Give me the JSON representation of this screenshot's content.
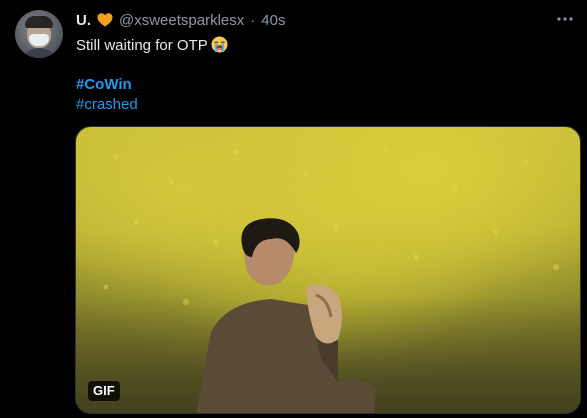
{
  "tweet": {
    "author_name": "U.",
    "heart_icon": "orange-heart-icon",
    "handle": "@xsweetsparklesx",
    "separator": "·",
    "time": "40s",
    "text": "Still waiting for OTP",
    "emoji_icon": "loudly-crying-face-icon",
    "hashtags": [
      "#CoWin",
      "#crashed"
    ],
    "media": {
      "type": "gif",
      "badge": "GIF"
    },
    "more_icon": "more-options-icon"
  },
  "colors": {
    "background": "#000000",
    "text": "#e7e9ea",
    "secondary": "#8b98a5",
    "link": "#1d9bf0",
    "heart": "#f5a01a"
  }
}
